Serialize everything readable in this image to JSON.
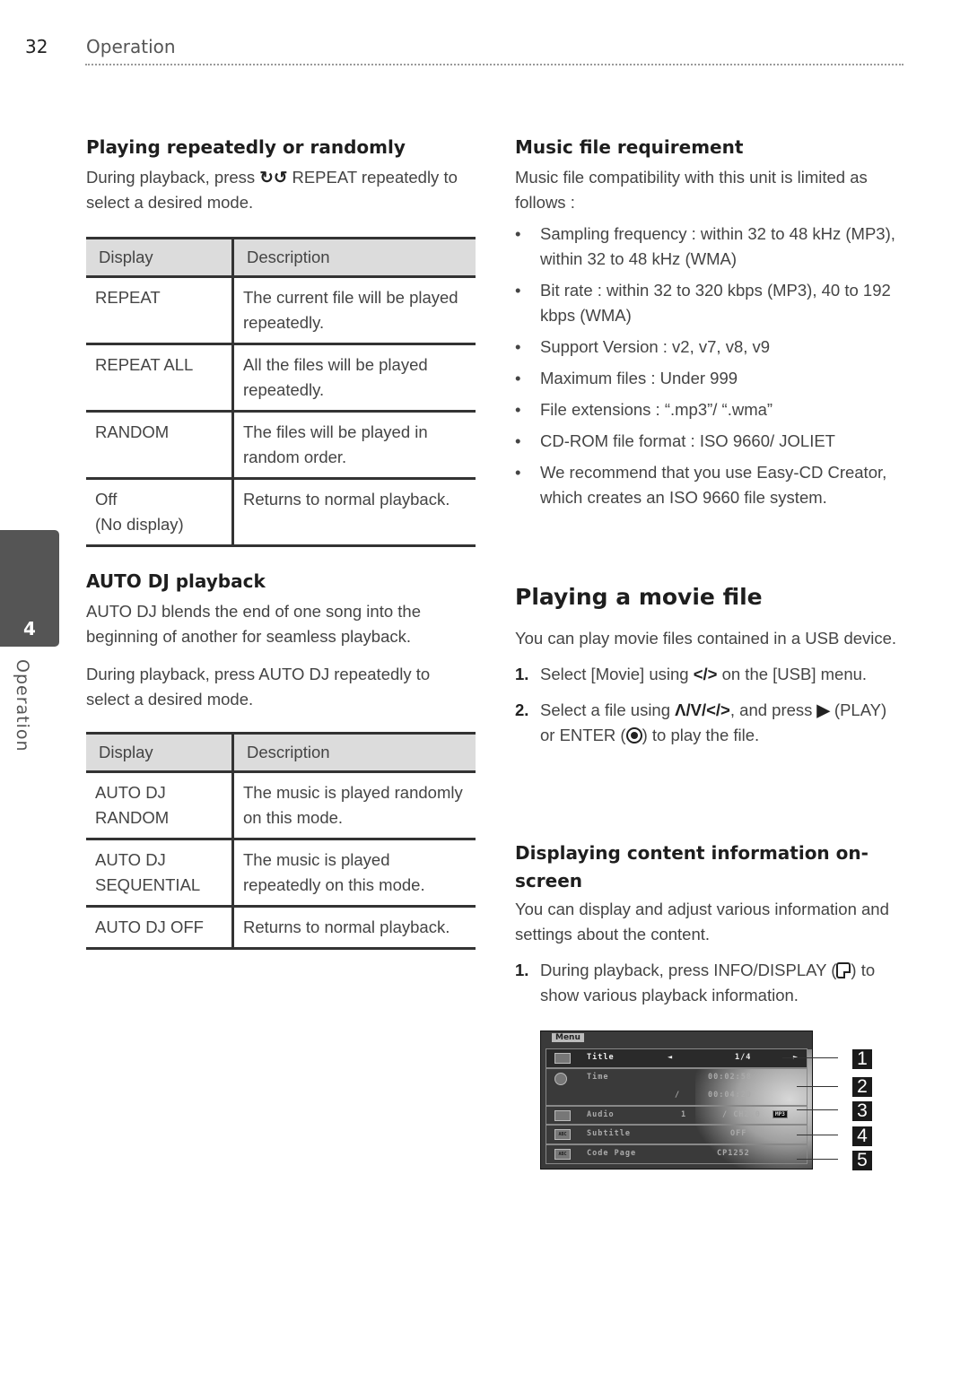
{
  "header": {
    "page_number": "32",
    "running_title": "Operation"
  },
  "side_tab": {
    "chapter_number": "4",
    "chapter_label": "Operation",
    "color": "#555555"
  },
  "repeat_section": {
    "title": "Playing repeatedly or randomly",
    "intro_before_icon": "During playback, press ",
    "icon": "repeat-icon",
    "intro_after_icon": " REPEAT repeatedly to select a desired mode.",
    "table": {
      "headers": [
        "Display",
        "Description"
      ],
      "rows": [
        {
          "display": "REPEAT",
          "description": "The current file will be played repeatedly."
        },
        {
          "display": "REPEAT ALL",
          "description": "All the files will be played repeatedly."
        },
        {
          "display": "RANDOM",
          "description": "The files will be played in random order."
        },
        {
          "display": "Off\n(No display)",
          "display_line1": "Off",
          "display_line2": "(No display)",
          "description": "Returns to normal playback."
        }
      ]
    }
  },
  "autodj_section": {
    "title": "AUTO DJ playback",
    "para1": "AUTO DJ blends the end of one song into the beginning of another for seamless playback.",
    "para2": "During playback, press AUTO DJ repeatedly to select a desired mode.",
    "table": {
      "headers": [
        "Display",
        "Description"
      ],
      "rows": [
        {
          "display_line1": "AUTO DJ",
          "display_line2": "RANDOM",
          "description": "The music is played randomly on this mode."
        },
        {
          "display_line1": "AUTO DJ",
          "display_line2": "SEQUENTIAL",
          "description": "The music is played repeatedly on this mode."
        },
        {
          "display_line1": "AUTO DJ OFF",
          "display_line2": "",
          "description": "Returns to normal playback."
        }
      ]
    }
  },
  "music_req_section": {
    "title": "Music file requirement",
    "intro": "Music file compatibility with this unit is limited as follows :",
    "bullet": "•",
    "items": [
      "Sampling frequency : within 32 to 48 kHz (MP3), within 32 to 48 kHz (WMA)",
      "Bit rate : within 32 to 320 kbps (MP3), 40 to 192 kbps (WMA)",
      "Support Version : v2, v7, v8, v9",
      "Maximum files : Under 999",
      "File extensions : “.mp3”/ “.wma”",
      "CD-ROM file format : ISO 9660/ JOLIET",
      "We recommend that you use Easy-CD Creator, which creates an ISO 9660 file system."
    ]
  },
  "movie_section": {
    "title": "Playing a movie file",
    "intro": "You can play movie files contained in a USB device.",
    "steps": [
      {
        "num": "1.",
        "before": "Select [Movie] using ",
        "glyph": "</>",
        "after": " on the [USB] menu."
      },
      {
        "num": "2.",
        "before": "Select a file using ",
        "glyph": "Λ/V/</>",
        "after_glyph": ", and press ",
        "play_glyph": "▶",
        "after_play": " (PLAY) or ENTER (",
        "enter_icon": "enter-icon",
        "end": ") to play the file."
      }
    ]
  },
  "display_info_section": {
    "title": "Displaying content information on-screen",
    "intro": "You can display and adjust various information and settings about the content.",
    "steps": [
      {
        "num": "1.",
        "before": "During playback, press INFO/DISPLAY (",
        "icon": "display-icon",
        "after": ") to show various playback information."
      }
    ]
  },
  "osd_screenshot": {
    "menu_label": "Menu",
    "rows": [
      {
        "icon": "film-icon",
        "label": "Title",
        "left_arrow": "◄",
        "value": "1/4",
        "right_arrow": "►"
      },
      {
        "icon": "clock-icon",
        "label": "Time",
        "value": "00:02:58",
        "value2_prefix": "/",
        "value2": "00:04:20"
      },
      {
        "icon": "speaker-icon",
        "label": "Audio",
        "value1": "1",
        "value": "/  CH2.0",
        "badge": "MP3"
      },
      {
        "icon": "subtitle-icon",
        "label": "Subtitle",
        "value": "OFF"
      },
      {
        "icon": "codepage-icon",
        "label": "Code Page",
        "value": "CP1252"
      }
    ],
    "callouts": [
      "1",
      "2",
      "3",
      "4",
      "5"
    ]
  }
}
